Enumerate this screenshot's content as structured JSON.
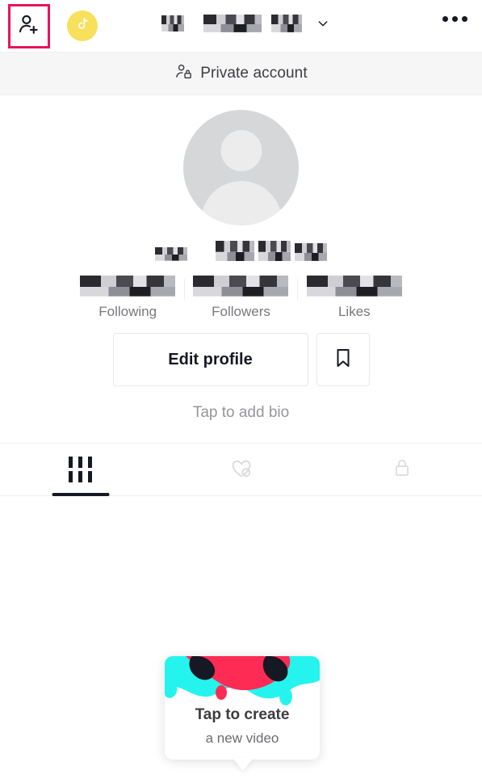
{
  "topbar": {
    "add_friend_icon": "person-add-icon",
    "coin_icon": "tiktok-coin-icon",
    "username_redacted": true,
    "chevron_icon": "chevron-down-icon",
    "more_icon": "more-options-icon",
    "highlight_color": "#e8145b",
    "coin_color": "#f7e05b"
  },
  "private_banner": {
    "icon": "person-lock-icon",
    "label": "Private account"
  },
  "profile": {
    "avatar_icon": "default-avatar-icon",
    "handle_redacted": true,
    "bio_placeholder": "Tap to add bio"
  },
  "stats": [
    {
      "label": "Following",
      "value_redacted": true
    },
    {
      "label": "Followers",
      "value_redacted": true
    },
    {
      "label": "Likes",
      "value_redacted": true
    }
  ],
  "buttons": {
    "edit_profile_label": "Edit profile",
    "bookmark_icon": "bookmark-icon"
  },
  "tabs": [
    {
      "icon": "grid-icon",
      "active": true
    },
    {
      "icon": "heart-slash-icon",
      "active": false
    },
    {
      "icon": "lock-icon",
      "active": false
    }
  ],
  "tooltip": {
    "title": "Tap to create",
    "subtitle": "a new video",
    "colors": {
      "cyan": "#25f4ee",
      "red": "#fe2c55",
      "black": "#161823"
    }
  }
}
